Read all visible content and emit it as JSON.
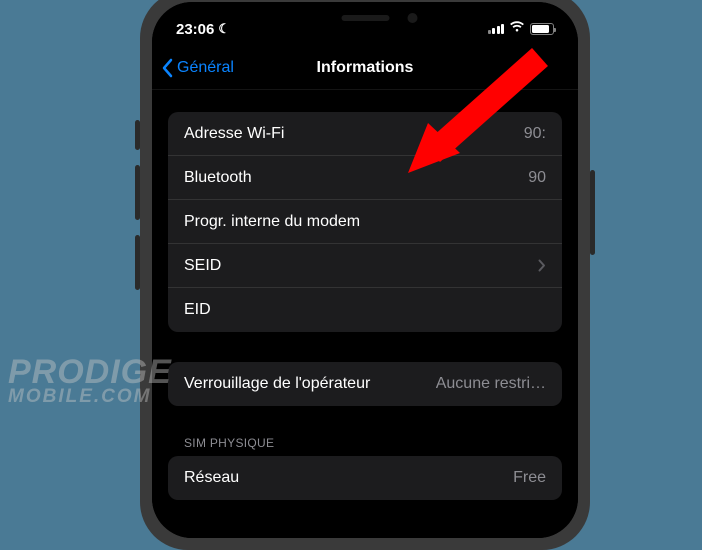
{
  "statusBar": {
    "time": "23:06"
  },
  "nav": {
    "back": "Général",
    "title": "Informations"
  },
  "group1": {
    "rows": [
      {
        "label": "Adresse Wi-Fi",
        "value": "90:"
      },
      {
        "label": "Bluetooth",
        "value": "90"
      },
      {
        "label": "Progr. interne du modem",
        "value": ""
      },
      {
        "label": "SEID",
        "value": ""
      },
      {
        "label": "EID",
        "value": ""
      }
    ]
  },
  "group2": {
    "rows": [
      {
        "label": "Verrouillage de l'opérateur",
        "value": "Aucune restri…"
      }
    ]
  },
  "group3": {
    "header": "SIM PHYSIQUE",
    "rows": [
      {
        "label": "Réseau",
        "value": "Free"
      }
    ]
  },
  "watermark": {
    "line1": "PRODIGE",
    "line2": "MOBILE.COM"
  }
}
